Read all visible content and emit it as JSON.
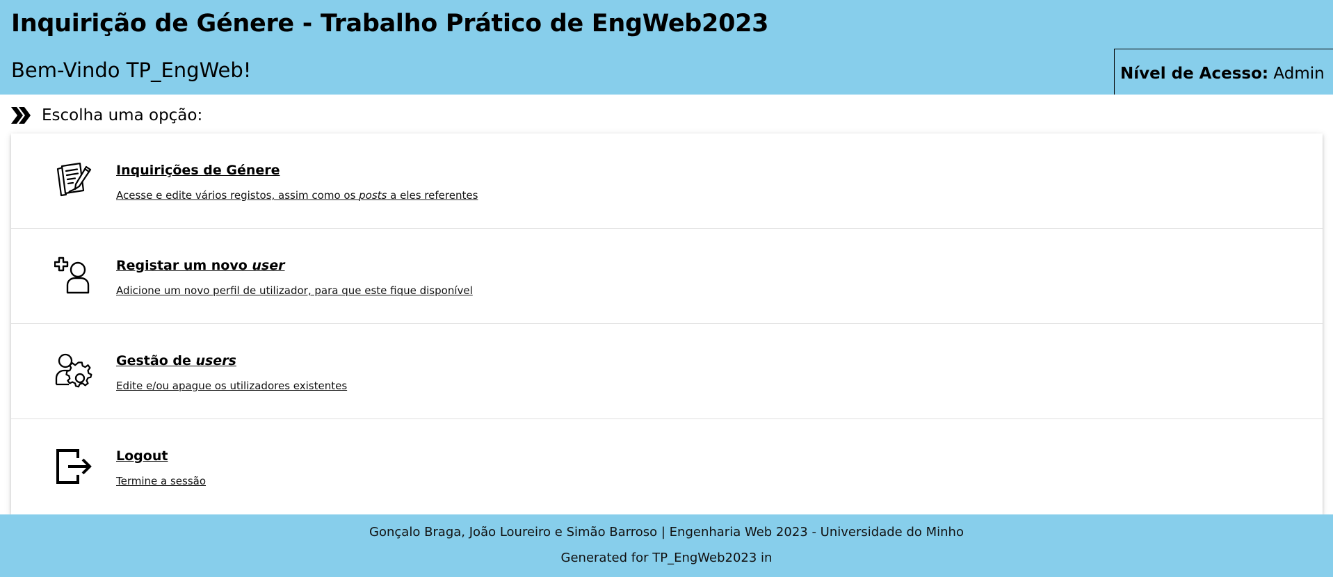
{
  "header": {
    "title": "Inquirição de Génere - Trabalho Prático de EngWeb2023",
    "welcome": "Bem-Vindo TP_EngWeb!",
    "access_label": "Nível de Acesso:",
    "access_value": "Admin"
  },
  "prompt": {
    "label": "Escolha uma opção:",
    "icon": "double-chevron-right-icon"
  },
  "options": [
    {
      "icon": "document-edit-icon",
      "title": "Inquirições de Génere",
      "title_em": "",
      "desc_before": "Acesse e edite vários registos, assim como os ",
      "desc_em": "posts",
      "desc_after": " a eles referentes"
    },
    {
      "icon": "add-user-icon",
      "title": "Registar um novo ",
      "title_em": "user",
      "desc_before": "Adicione um novo perfil de utilizador, para que este fique disponível",
      "desc_em": "",
      "desc_after": ""
    },
    {
      "icon": "user-settings-icon",
      "title": "Gestão de ",
      "title_em": "users",
      "desc_before": "Edite e/ou apague os utilizadores existentes",
      "desc_em": "",
      "desc_after": ""
    },
    {
      "icon": "logout-icon",
      "title": "Logout",
      "title_em": "",
      "desc_before": "Termine a sessão",
      "desc_em": "",
      "desc_after": ""
    }
  ],
  "footer": {
    "credits": "Gonçalo Braga, João Loureiro e Simão Barroso | Engenharia Web 2023 - Universidade do Minho",
    "generated": "Generated for TP_EngWeb2023 in"
  },
  "colors": {
    "header_bg": "#87ceeb",
    "footer_bg": "#87ceeb"
  }
}
